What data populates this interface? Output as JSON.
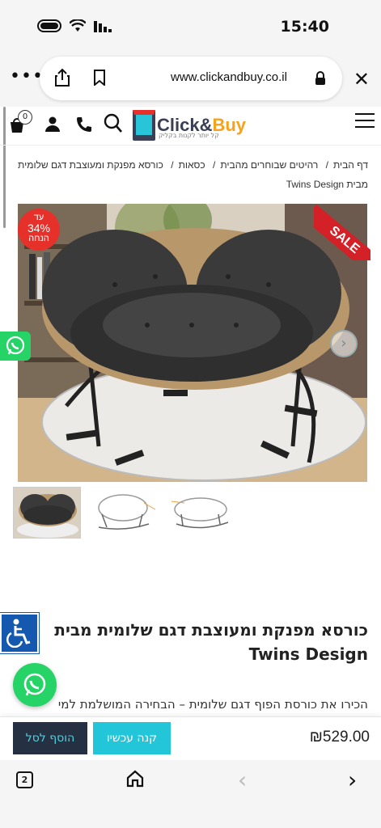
{
  "status_bar": {
    "time": "15:40"
  },
  "browser": {
    "url": "www.clickandbuy.co.il",
    "icons": [
      "more-icon",
      "share-icon",
      "bookmark-icon",
      "lock-icon",
      "close-icon"
    ]
  },
  "site_header": {
    "cart_count": "0",
    "logo_click": "Click&",
    "logo_buy": "Buy",
    "logo_tagline": "קל יותר לקנות בקליק"
  },
  "breadcrumb": {
    "items": [
      "דף הבית",
      "רהיטים שבוחרים מהבית",
      "כסאות",
      "כורסא מפנקת ומעוצבת דגם שלומית מבית Twins Design"
    ]
  },
  "product": {
    "discount_prefix": "עד",
    "discount_percent": "34%",
    "discount_suffix": "הנחה",
    "sale_label": "SALE",
    "title": "כורסא מפנקת ומעוצבת דגם שלומית מבית Twins Design",
    "description": "הכירו את כורסת הפוף דגם שלומית – הבחירה המושלמת למי"
  },
  "buy_bar": {
    "add_to_cart": "הוסף לסל",
    "buy_now": "קנה עכשיו",
    "price": "₪529.00"
  },
  "bottom_toolbar": {
    "tabs_count": "2"
  },
  "colors": {
    "accent_teal": "#23c6d9",
    "dark_navy": "#253043",
    "sale_red": "#d42027",
    "whatsapp_green": "#25d366",
    "logo_orange": "#f7a21b"
  }
}
